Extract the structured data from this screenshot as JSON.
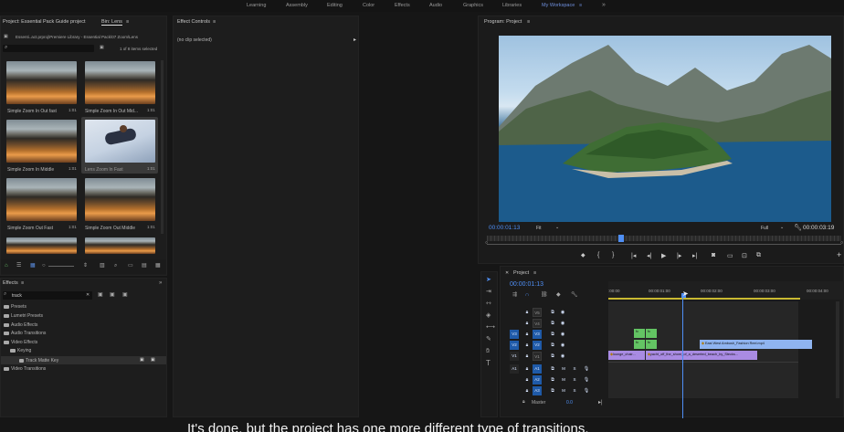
{
  "workspaces": [
    "Learning",
    "Assembly",
    "Editing",
    "Color",
    "Effects",
    "Audio",
    "Graphics",
    "Libraries"
  ],
  "workspace_active": "My Workspace",
  "project": {
    "tab_title": "Project: Essential Pack Guide project",
    "tab2": "Bin: Lens",
    "path": "Essenti..act.prproj\\Premiere Library - Essential Pack\\07 Zoom\\Lens",
    "count": "1 of 8 items selected"
  },
  "thumbs": [
    {
      "label": "Simple Zoom In Out fast",
      "dur": "1:01"
    },
    {
      "label": "Simple Zoom In Out Mid...",
      "dur": "1:01"
    },
    {
      "label": "Simple Zoom In Middle",
      "dur": "1:01"
    },
    {
      "label": "Lens Zoom In Fast",
      "dur": "1:01"
    },
    {
      "label": "Simple Zoom Out Fast",
      "dur": "1:01"
    },
    {
      "label": "Simple Zoom Out Middle",
      "dur": "1:01"
    }
  ],
  "effect_controls": {
    "title": "Effect Controls",
    "empty": "(no clip selected)"
  },
  "program": {
    "title": "Program: Project",
    "timecode": "00:00:01:13",
    "fit": "Fit",
    "quality": "Full",
    "duration": "00:00:03:19"
  },
  "effects": {
    "title": "Effects",
    "search": "track",
    "items": [
      "Presets",
      "Lumetri Presets",
      "Audio Effects",
      "Audio Transitions",
      "Video Effects",
      "Keying",
      "Track Matte Key",
      "Video Transitions"
    ]
  },
  "timeline": {
    "tab": "Project",
    "timecode": "00:00:01:13",
    "ruler": [
      ":00:00",
      "00:00:01:00",
      "00:00:02:00",
      "00:00:03:00",
      "00:00:04:00"
    ],
    "video_tracks": [
      "V5",
      "V4",
      "V3",
      "V2",
      "V1"
    ],
    "audio_tracks": [
      "A1",
      "A2",
      "A3"
    ],
    "master": "Master",
    "master_val": "0.0",
    "clips": {
      "top": "East West Ambush_Fashion Reel.mp4",
      "v1a": "lounge_chair...",
      "v1b": "yacht_off_the_shore_of_a_deserted_beach_by_Stecks..."
    }
  },
  "caption": "It's done, but the project has one more different type of transitions.",
  "colors": {
    "accent": "#4f8ff5",
    "panel": "#1d1d1d",
    "clip_green": "#63c463",
    "clip_violet": "#a98be3",
    "clip_blue": "#8fb4f0"
  }
}
